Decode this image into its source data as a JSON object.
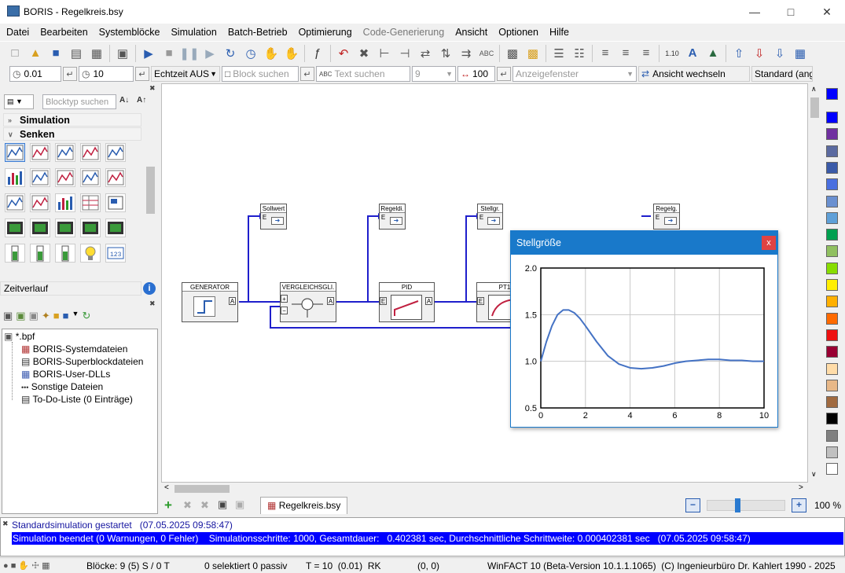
{
  "window": {
    "title": "BORIS - Regelkreis.bsy"
  },
  "menu": [
    "Datei",
    "Bearbeiten",
    "Systemblöcke",
    "Simulation",
    "Batch-Betrieb",
    "Optimierung",
    "Code-Generierung",
    "Ansicht",
    "Optionen",
    "Hilfe"
  ],
  "toolbar2": {
    "step_value": "0.01",
    "end_value": "10",
    "realtime": "Echtzeit AUS",
    "block_search_placeholder": "Block suchen",
    "text_search_placeholder": "Text suchen",
    "count_value": "9",
    "width_value": "100",
    "display_window_placeholder": "Anzeigefenster",
    "switch_view": "Ansicht wechseln",
    "standard": "Standard (ange"
  },
  "library": {
    "search_placeholder": "Blocktyp suchen",
    "categories": [
      "Simulation",
      "Senken"
    ],
    "selected_label": "Zeitverlauf"
  },
  "files": {
    "root": "*.bpf",
    "items": [
      "BORIS-Systemdateien",
      "BORIS-Superblockdateien",
      "BORIS-User-DLLs",
      "Sonstige Dateien",
      "To-Do-Liste (0 Einträge)"
    ]
  },
  "blocks": {
    "generator": "GENERATOR",
    "compare": "VERGLEICHSGLI.",
    "pid": "PID",
    "pt1": "PT1",
    "sollwert": "Sollwert",
    "regeldi": "Regeldi.",
    "stellgr": "Stellgr.",
    "regelg": "Regelg."
  },
  "tabs": {
    "document": "Regelkreis.bsy",
    "zoom": "100 %"
  },
  "popup": {
    "title": "Stellgröße",
    "close": "x"
  },
  "chart_data": {
    "type": "line",
    "title": "",
    "xlabel": "",
    "ylabel": "",
    "xlim": [
      0,
      10
    ],
    "ylim": [
      0.5,
      2.0
    ],
    "xticks": [
      "0",
      "2",
      "4",
      "6",
      "8",
      "10"
    ],
    "yticks": [
      "0.5",
      "1.0",
      "1.5",
      "2.0"
    ],
    "grid": true,
    "series": [
      {
        "color": "#4472c4",
        "x": [
          0,
          0.25,
          0.5,
          0.75,
          1,
          1.25,
          1.5,
          1.75,
          2,
          2.5,
          3,
          3.5,
          4,
          4.5,
          5,
          5.5,
          6,
          6.5,
          7,
          7.5,
          8,
          8.5,
          9,
          9.5,
          10
        ],
        "y": [
          1.0,
          1.21,
          1.38,
          1.5,
          1.55,
          1.55,
          1.52,
          1.46,
          1.38,
          1.21,
          1.06,
          0.97,
          0.93,
          0.92,
          0.93,
          0.95,
          0.98,
          1.0,
          1.01,
          1.02,
          1.02,
          1.01,
          1.01,
          1.0,
          1.0
        ]
      }
    ]
  },
  "colors": [
    "#0000ff",
    "#7030a0",
    "#5b6aa0",
    "#3a5aa8",
    "#4a6fe0",
    "#6a90d0",
    "#5fa0d8",
    "#00a050",
    "#90c060",
    "#88dd00",
    "#ffee00",
    "#ffb000",
    "#ff6a00",
    "#ee1111",
    "#990033",
    "#ffdca8",
    "#e8b888",
    "#a06a40",
    "#000000",
    "#808080",
    "#c0c0c0",
    "#ffffff"
  ],
  "messages": {
    "line1": "Standardsimulation gestartet   (07.05.2025 09:58:47)",
    "line2": "Simulation beendet (0 Warnungen, 0 Fehler)    Simulationsschritte: 1000, Gesamtdauer:   0.402381 sec, Durchschnittliche Schrittweite: 0.000402381 sec   (07.05.2025 09:58:47)"
  },
  "status": {
    "blocks": "Blöcke: 9 (5) S / 0 T",
    "selected": "0 selektiert  0 passiv",
    "time": "T = 10  (0.01)  RK",
    "coords": "(0, 0)",
    "version": "WinFACT 10 (Beta-Version 10.1.1.1065)  (C) Ingenieurbüro Dr. Kahlert 1990 - 2025"
  }
}
